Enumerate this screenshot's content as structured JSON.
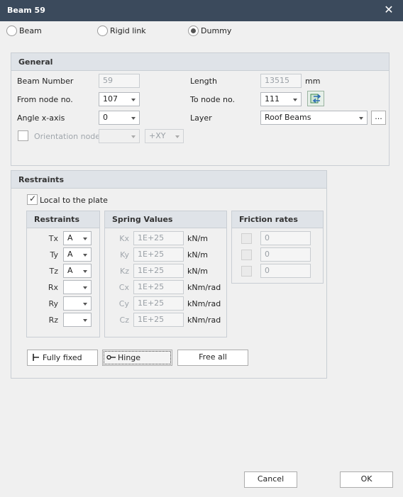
{
  "window": {
    "title": "Beam 59",
    "close_glyph": "✕"
  },
  "type_options": [
    {
      "label": "Beam",
      "selected": false
    },
    {
      "label": "Rigid link",
      "selected": false
    },
    {
      "label": "Dummy",
      "selected": true
    }
  ],
  "general": {
    "title": "General",
    "beam_number": {
      "label": "Beam Number",
      "value": "59"
    },
    "length": {
      "label": "Length",
      "value": "13515",
      "unit": "mm"
    },
    "from_node": {
      "label": "From node no.",
      "value": "107"
    },
    "to_node": {
      "label": "To node no.",
      "value": "111"
    },
    "swap_icon": "swap-nodes-icon",
    "angle": {
      "label": "Angle x-axis",
      "value": "0"
    },
    "layer": {
      "label": "Layer",
      "value": "Roof Beams",
      "more_label": "..."
    },
    "orientation": {
      "label": "Orientation node",
      "checked": false,
      "node_value": "",
      "axis_value": "+XY"
    }
  },
  "restraints": {
    "title": "Restraints",
    "local_label": "Local to the plate",
    "local_checked": true,
    "restraints_panel_title": "Restraints",
    "spring_panel_title": "Spring Values",
    "friction_panel_title": "Friction rates",
    "rows": [
      {
        "dof": "Tx",
        "value": "A",
        "spring_label": "Kx",
        "spring_value": "1E+25",
        "unit": "kN/m"
      },
      {
        "dof": "Ty",
        "value": "A",
        "spring_label": "Ky",
        "spring_value": "1E+25",
        "unit": "kN/m"
      },
      {
        "dof": "Tz",
        "value": "A",
        "spring_label": "Kz",
        "spring_value": "1E+25",
        "unit": "kN/m"
      },
      {
        "dof": "Rx",
        "value": "",
        "spring_label": "Cx",
        "spring_value": "1E+25",
        "unit": "kNm/rad"
      },
      {
        "dof": "Ry",
        "value": "",
        "spring_label": "Cy",
        "spring_value": "1E+25",
        "unit": "kNm/rad"
      },
      {
        "dof": "Rz",
        "value": "",
        "spring_label": "Cz",
        "spring_value": "1E+25",
        "unit": "kNm/rad"
      }
    ],
    "friction": [
      {
        "checked": false,
        "value": "0"
      },
      {
        "checked": false,
        "value": "0"
      },
      {
        "checked": false,
        "value": "0"
      }
    ],
    "buttons": {
      "fully_fixed": "Fully fixed",
      "hinge": "Hinge",
      "free_all": "Free all"
    }
  },
  "footer": {
    "cancel": "Cancel",
    "ok": "OK"
  }
}
